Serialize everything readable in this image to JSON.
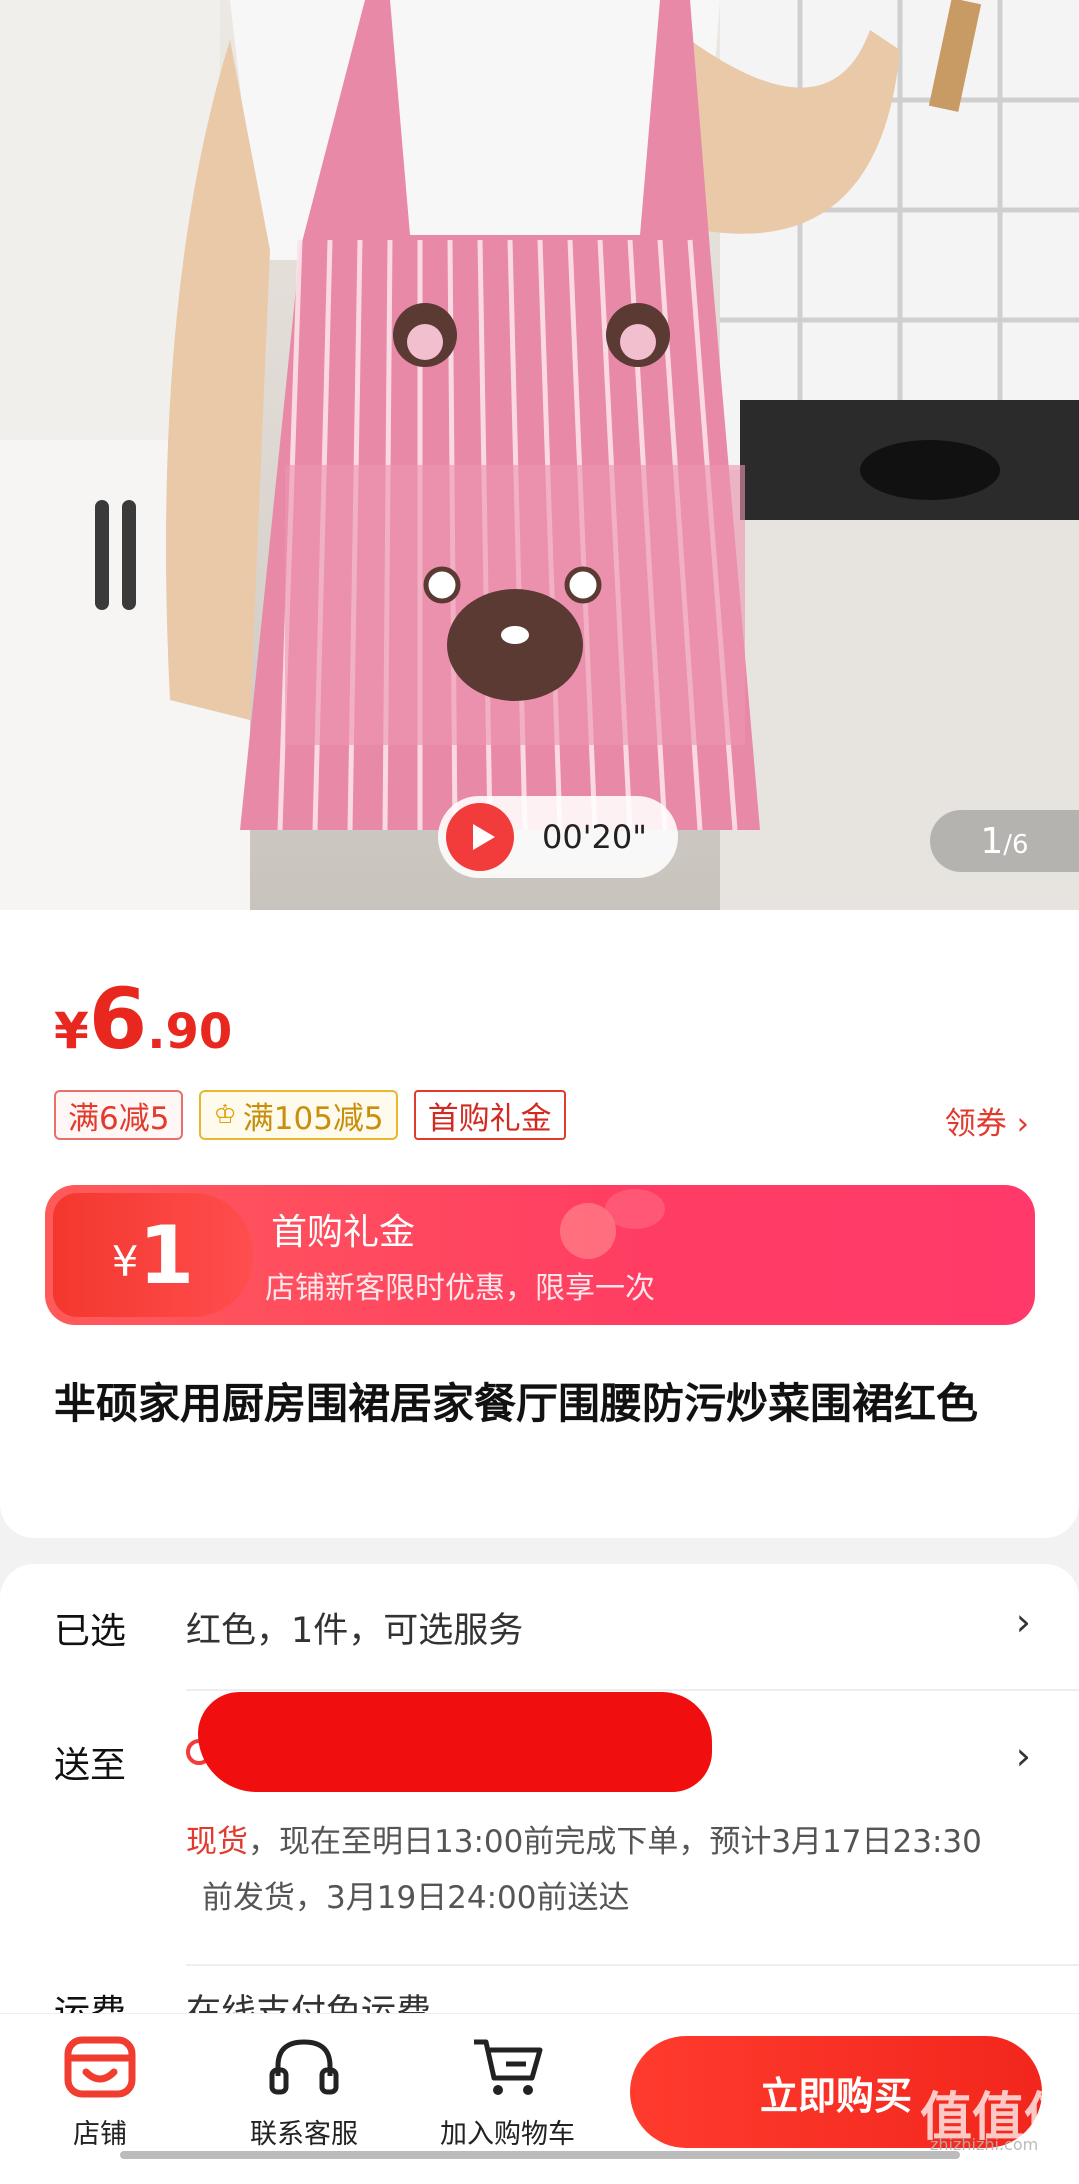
{
  "hero": {
    "video_duration": "00'20\"",
    "page_current": "1",
    "page_total": "/6"
  },
  "price": {
    "currency": "¥",
    "integer": "6",
    "decimal": ".90"
  },
  "tags": [
    {
      "label": "满6减5"
    },
    {
      "label": "满105减5"
    },
    {
      "label": "首购礼金"
    }
  ],
  "coupon_link": "领券 ›",
  "banner": {
    "currency": "¥",
    "amount": "1",
    "title": "首购礼金",
    "subtitle": "店铺新客限时优惠，限享一次"
  },
  "product_title": "芈硕家用厨房围裙居家餐厅围腰防污炒菜围裙红色",
  "selected": {
    "label": "已选",
    "value": "红色，1件，可选服务"
  },
  "ship_to": {
    "label": "送至",
    "stock": "现货",
    "line1": "，现在至明日13:00前完成下单，预计3月17日23:30",
    "line2": "前发货，3月19日24:00前送达"
  },
  "freight": {
    "label": "运费",
    "value": "在线支付免运费"
  },
  "bottom_bar": {
    "shop": "店铺",
    "service": "联系客服",
    "cart": "加入购物车",
    "buy_now": "立即购买"
  },
  "watermark": {
    "logo": "值值值",
    "url": "zhizhizhi.com"
  },
  "colors": {
    "accent": "#e8281f",
    "banner": "#ff3d63",
    "gold": "#c98e0c"
  }
}
